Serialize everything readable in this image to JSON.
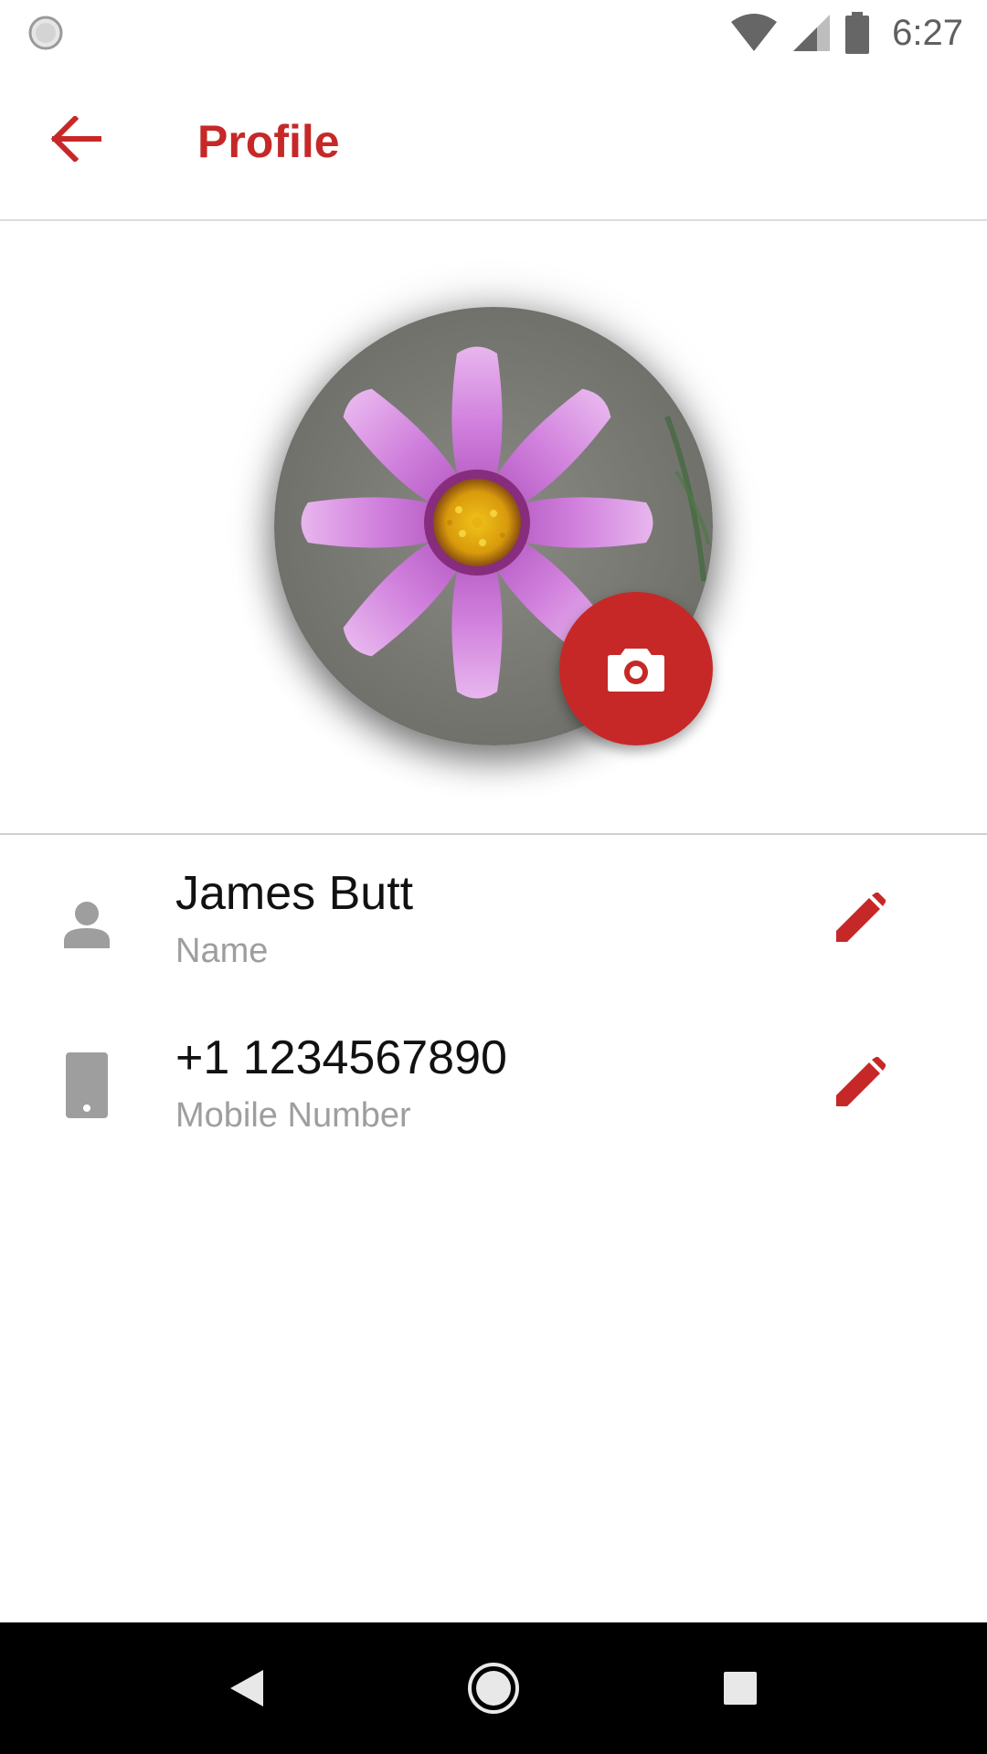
{
  "status_bar": {
    "time": "6:27",
    "icons": [
      "loading-spinner-icon",
      "wifi-icon",
      "cell-signal-icon",
      "battery-icon"
    ]
  },
  "app_bar": {
    "title": "Profile",
    "back_icon": "arrow-left-icon"
  },
  "avatar": {
    "image": "pink cosmos flower photo",
    "camera_icon": "camera-icon"
  },
  "fields": [
    {
      "icon": "person-icon",
      "value": "James Butt",
      "label": "Name",
      "edit_icon": "pencil-icon"
    },
    {
      "icon": "phone-icon",
      "value": "+1 1234567890",
      "label": "Mobile Number",
      "edit_icon": "pencil-icon"
    }
  ],
  "nav_bar": {
    "icons": [
      "back-triangle-icon",
      "home-circle-icon",
      "recents-square-icon"
    ]
  },
  "colors": {
    "accent": "#c62828",
    "label_gray": "#9e9e9e",
    "icon_gray": "#9e9e9e"
  }
}
